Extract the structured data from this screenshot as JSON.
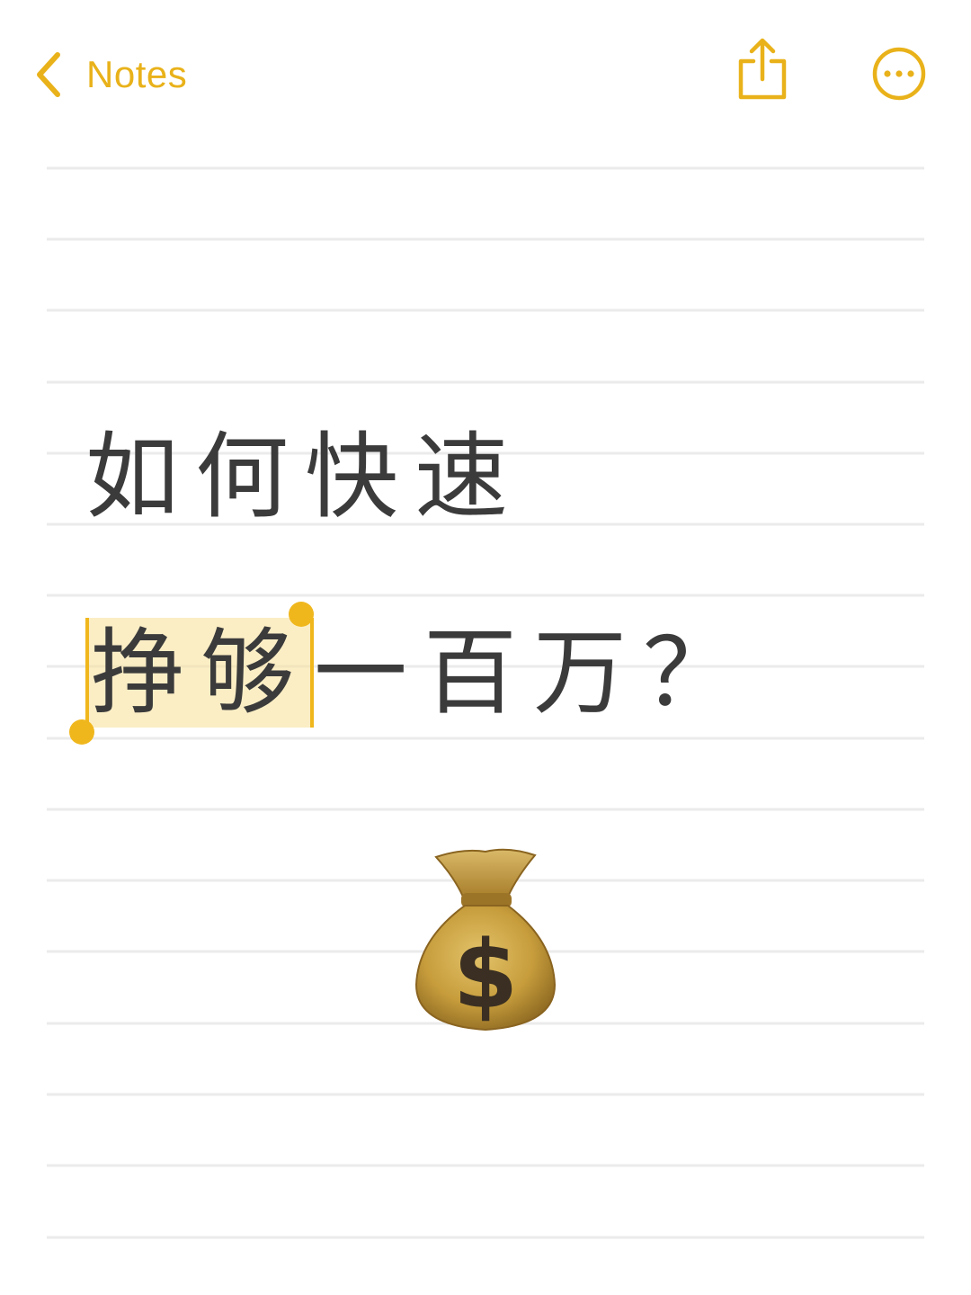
{
  "nav": {
    "back_label": "Notes",
    "share_icon": "share-icon",
    "more_icon": "ellipsis-circle-icon",
    "accent_color": "#e9b21a"
  },
  "note": {
    "line1": "如何快速",
    "line2_selected": "挣够",
    "line2_rest": "一百万？",
    "emoji_icon": "money-bag-icon",
    "selection_color": "#f0b71d"
  }
}
